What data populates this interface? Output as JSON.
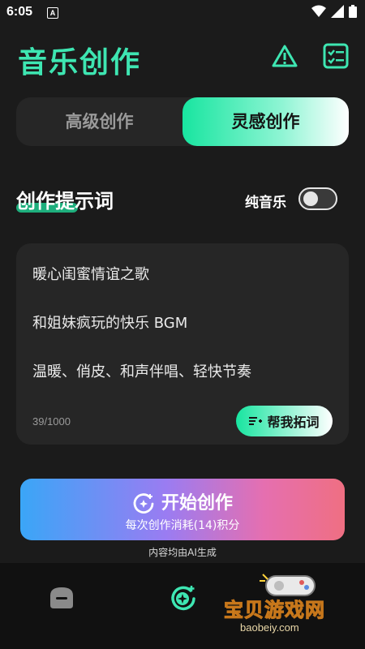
{
  "status_bar": {
    "time": "6:05",
    "notification_letter": "A"
  },
  "header": {
    "title": "音乐创作",
    "warning_icon": "warning-triangle-icon",
    "checklist_icon": "checklist-icon"
  },
  "tabs": {
    "advanced": "高级创作",
    "inspiration": "灵感创作",
    "active": "inspiration"
  },
  "prompt_section": {
    "title": "创作提示词",
    "toggle_label": "纯音乐",
    "toggle_on": false,
    "lines": [
      "暖心闺蜜情谊之歌",
      "和姐妹疯玩的快乐 BGM",
      "温暖、俏皮、和声伴唱、轻快节奏"
    ],
    "counter": "39/1000",
    "expand_button": "帮我拓词"
  },
  "start_button": {
    "label": "开始创作",
    "sub": "每次创作消耗(14)积分"
  },
  "ai_note": "内容均由AI生成",
  "bottom_nav": {
    "items": [
      "home-icon",
      "create-icon"
    ]
  },
  "watermark": {
    "text": "宝贝游戏网",
    "url": "baobeiy.com"
  },
  "colors": {
    "accent": "#3ee6b2",
    "background": "#1b1b1b",
    "card": "#262626"
  }
}
